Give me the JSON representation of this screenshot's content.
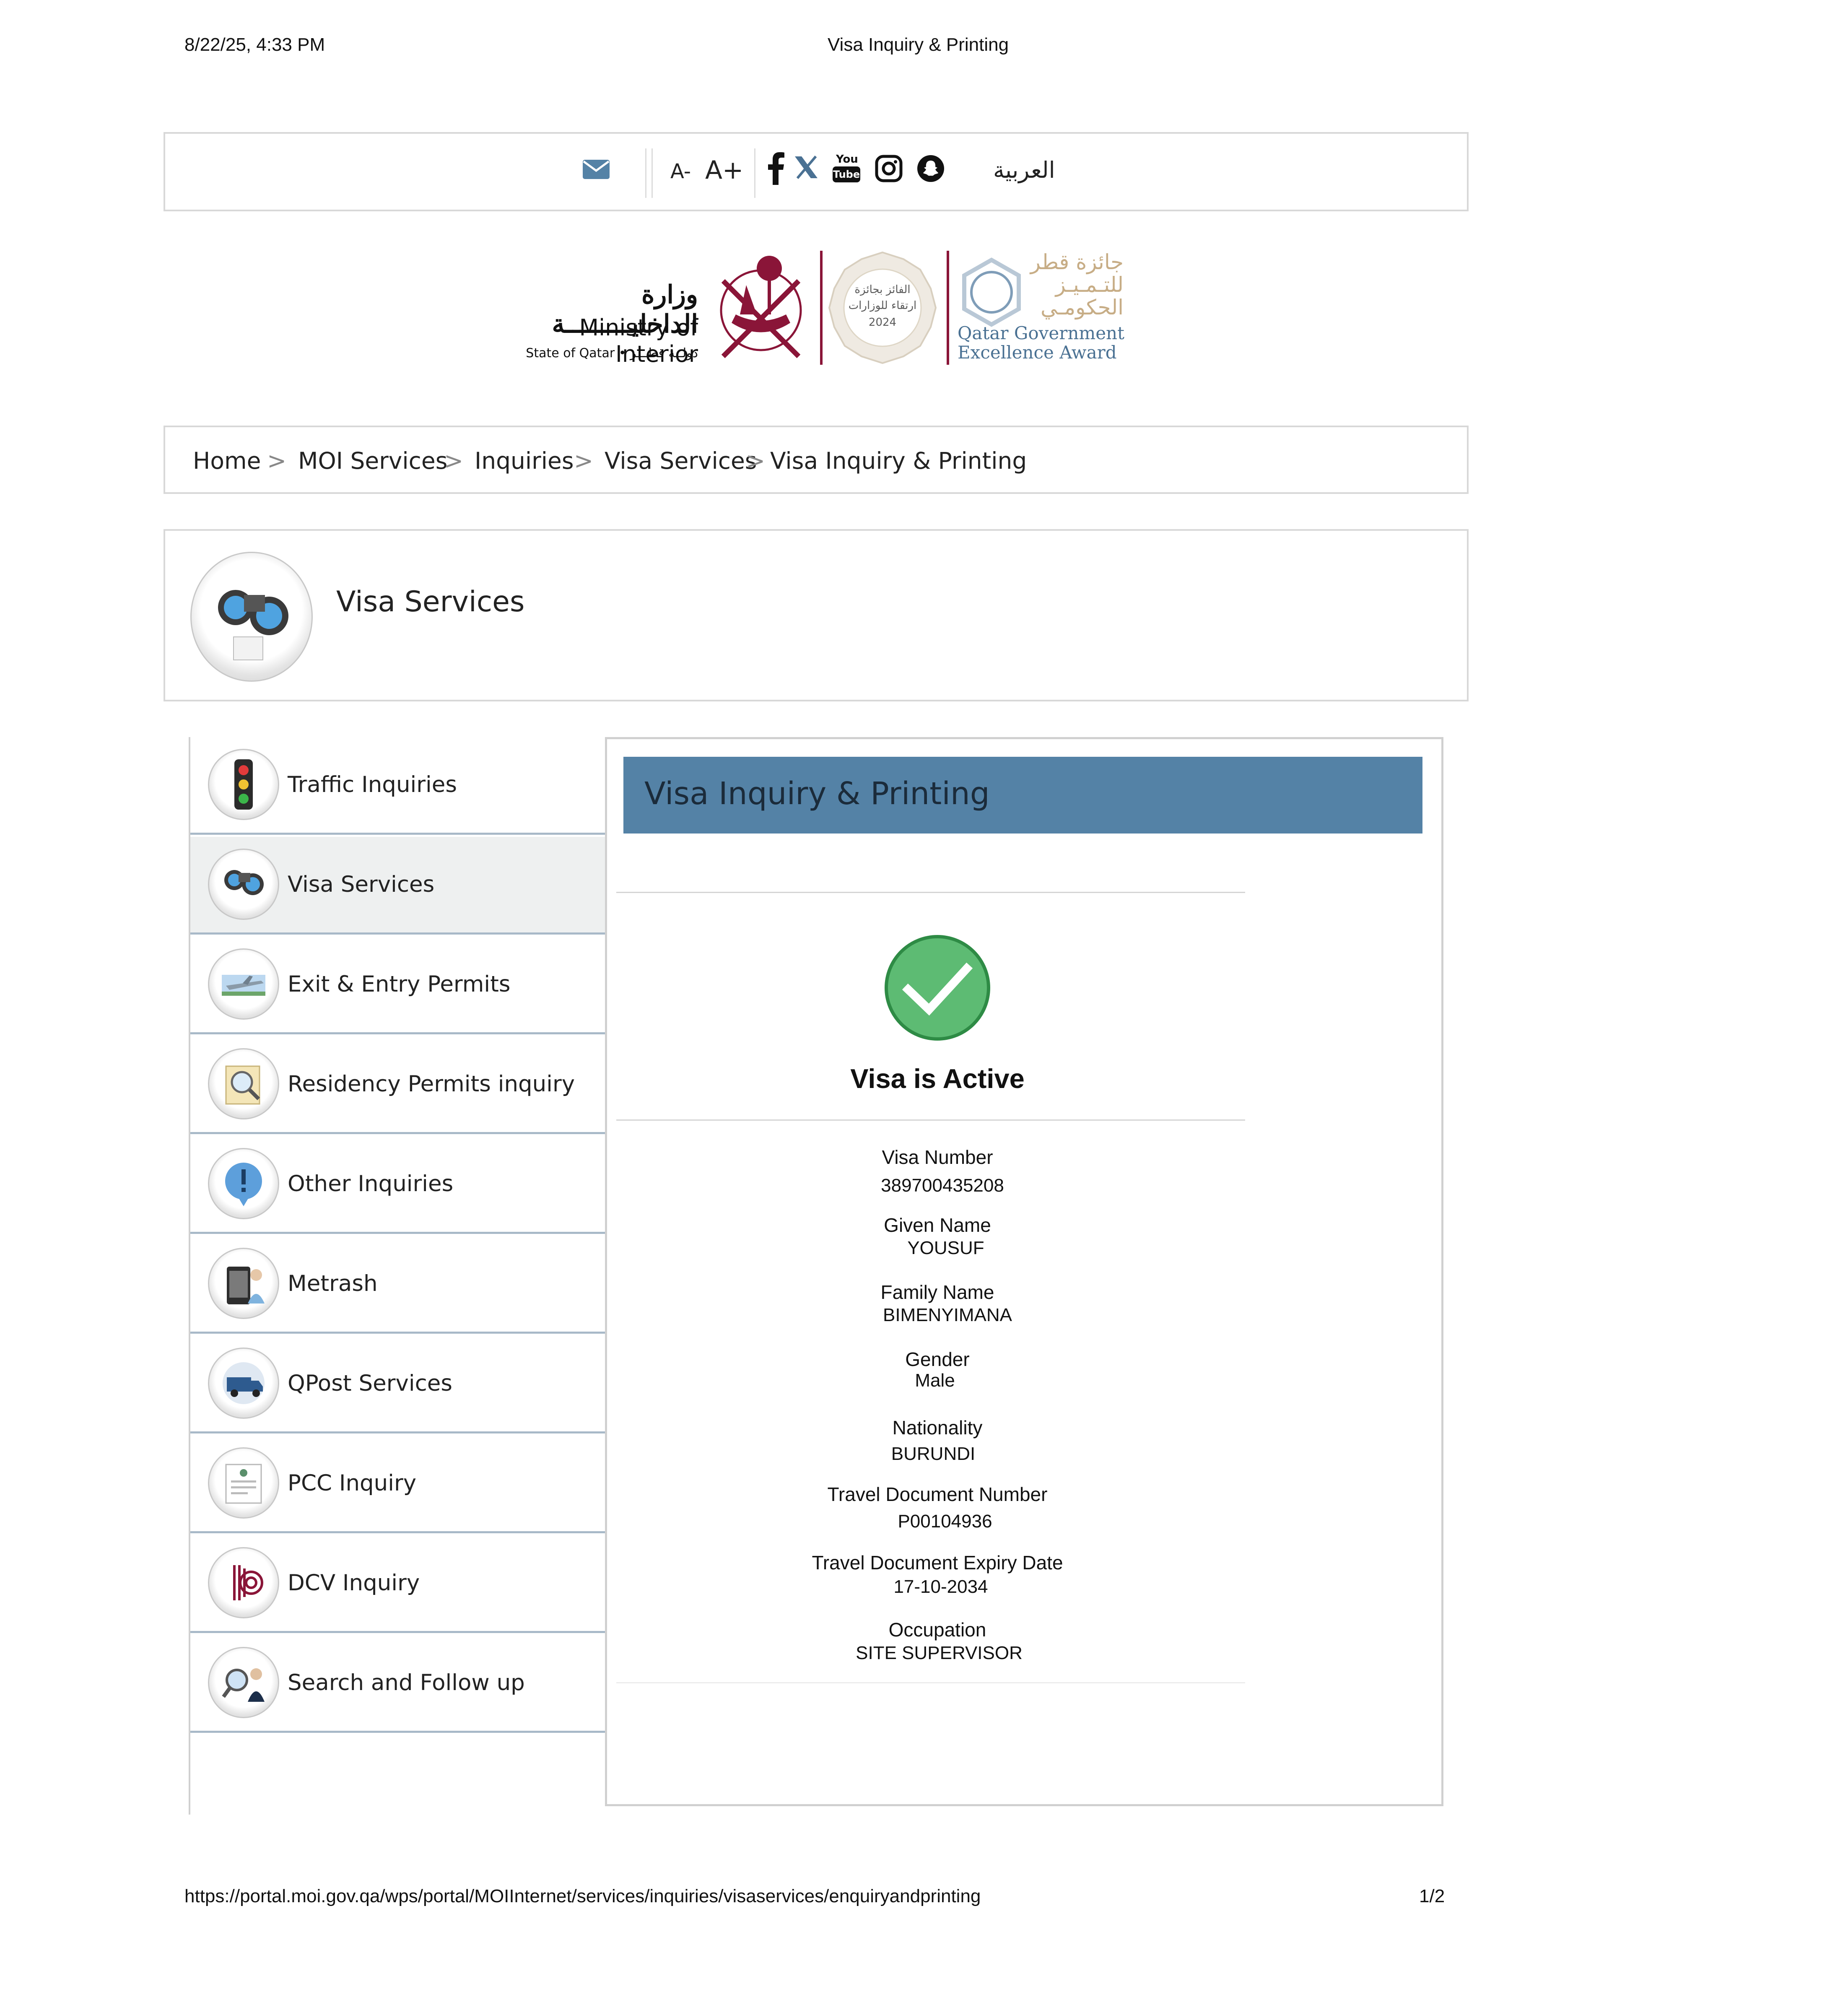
{
  "print": {
    "datetime": "8/22/25, 4:33 PM",
    "page_title": "Visa Inquiry & Printing",
    "url": "https://portal.moi.gov.qa/wps/portal/MOIInternet/services/inquiries/visaservices/enquiryandprinting",
    "page_number": "1/2"
  },
  "toolbar": {
    "font_decrease": "A-",
    "font_increase": "A+",
    "arabic_link": "العربية",
    "icons": [
      "mail-icon",
      "facebook-icon",
      "x-twitter-icon",
      "youtube-icon",
      "instagram-icon",
      "snapchat-icon"
    ],
    "youtube_text_top": "You",
    "youtube_text_bottom": "Tube"
  },
  "logos": {
    "moi_arabic": "وزارة الداخليـــــــــة",
    "moi_english": "Ministry of Interior",
    "moi_state": "State of Qatar • دولــة قطـــر",
    "award_badge_line1": "الفائز بجائزة",
    "award_badge_line2": "ارتقاء للوزارات",
    "award_badge_year": "2024",
    "award_arabic_1": "جائزة قطر",
    "award_arabic_2": "للتـمـيـز",
    "award_arabic_3": "الحكومـي",
    "award_english_1": "Qatar Government",
    "award_english_2": "Excellence Award"
  },
  "breadcrumb": {
    "items": [
      "Home",
      "MOI Services",
      "Inquiries",
      "Visa Services",
      "Visa Inquiry & Printing"
    ],
    "separator": ">"
  },
  "section": {
    "title": "Visa Services",
    "icon": "binoculars-icon"
  },
  "sidebar": {
    "items": [
      {
        "label": "Traffic Inquiries",
        "icon": "traffic-light-icon"
      },
      {
        "label": "Visa Services",
        "icon": "binoculars-icon",
        "active": true
      },
      {
        "label": "Exit & Entry Permits",
        "icon": "airplane-icon"
      },
      {
        "label": "Residency Permits inquiry",
        "icon": "magnifier-document-icon"
      },
      {
        "label": "Other Inquiries",
        "icon": "exclamation-icon"
      },
      {
        "label": "Metrash",
        "icon": "phone-person-icon"
      },
      {
        "label": "QPost Services",
        "icon": "delivery-truck-icon"
      },
      {
        "label": "PCC Inquiry",
        "icon": "certificate-icon"
      },
      {
        "label": "DCV Inquiry",
        "icon": "fingerprint-icon"
      },
      {
        "label": "Search and Follow up",
        "icon": "officer-search-icon"
      }
    ]
  },
  "panel": {
    "title": "Visa Inquiry & Printing",
    "status_icon": "check-circle-icon",
    "status_text": "Visa is Active",
    "status_color": "#5dbb73",
    "accent_color": "#5482a6",
    "fields": [
      {
        "label": "Visa Number",
        "value": "389700435208"
      },
      {
        "label": "Given Name",
        "value": "YOUSUF"
      },
      {
        "label": "Family Name",
        "value": "BIMENYIMANA"
      },
      {
        "label": "Gender",
        "value": "Male"
      },
      {
        "label": "Nationality",
        "value": "BURUNDI"
      },
      {
        "label": "Travel Document Number",
        "value": "P00104936"
      },
      {
        "label": "Travel Document Expiry Date",
        "value": "17-10-2034"
      },
      {
        "label": "Occupation",
        "value": "SITE SUPERVISOR"
      }
    ]
  }
}
